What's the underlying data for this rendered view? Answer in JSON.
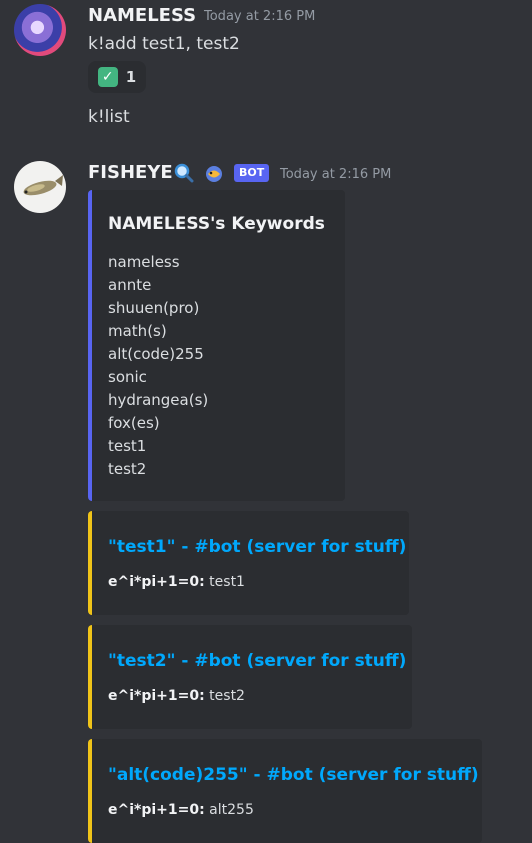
{
  "messages": [
    {
      "username": "NAMELESS",
      "timestamp": "Today at 2:16 PM",
      "lines": [
        "k!add test1, test2",
        "k!list"
      ],
      "reaction": {
        "emoji": "✓",
        "count": "1"
      }
    },
    {
      "username": "FISHEYE",
      "timestamp": "Today at 2:16 PM",
      "badge": "BOT",
      "embeds": [
        {
          "title": "NAMELESS's Keywords",
          "items": [
            "nameless",
            "annte",
            "shuuen(pro)",
            "math(s)",
            "alt(code)255",
            "sonic",
            "hydrangea(s)",
            "fox(es)",
            "test1",
            "test2"
          ],
          "bar_color": "#5865f2"
        },
        {
          "title": "\"test1\" - #bot (server for stuff)",
          "field_name": "e^i*pi+1=0:",
          "field_value": "test1",
          "bar_color": "#f0c419"
        },
        {
          "title": "\"test2\" - #bot (server for stuff)",
          "field_name": "e^i*pi+1=0:",
          "field_value": "test2",
          "bar_color": "#f0c419"
        },
        {
          "title": "\"alt(code)255\" - #bot (server for stuff)",
          "field_name": "e^i*pi+1=0:",
          "field_value": "alt255",
          "bar_color": "#f0c419"
        }
      ]
    }
  ],
  "colors": {
    "background": "#313338",
    "embed_bg": "#2b2d31",
    "link": "#00a8fc",
    "bot_tag": "#5865f2"
  }
}
